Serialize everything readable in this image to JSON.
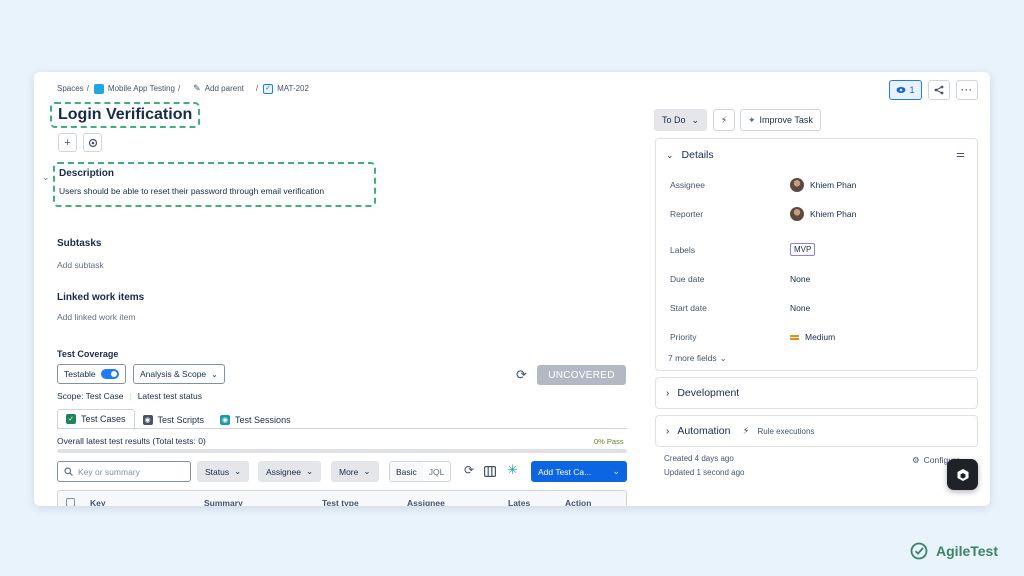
{
  "breadcrumb": {
    "spaces": "Spaces",
    "project": "Mobile App Testing",
    "add_parent": "Add parent",
    "issue_key": "MAT-202"
  },
  "header": {
    "watch_count": "1"
  },
  "issue": {
    "title": "Login Verification",
    "description_heading": "Description",
    "description": "Users should be able to reset their password through email verification"
  },
  "subtasks": {
    "heading": "Subtasks",
    "placeholder": "Add subtask"
  },
  "linked": {
    "heading": "Linked work items",
    "placeholder": "Add linked work item"
  },
  "test_coverage": {
    "heading": "Test Coverage",
    "testable_label": "Testable",
    "analysis_label": "Analysis & Scope",
    "uncovered_label": "UNCOVERED",
    "scope_label": "Scope: Test Case",
    "latest_status_label": "Latest test status",
    "tabs": [
      {
        "label": "Test Cases",
        "color": "#1f845a"
      },
      {
        "label": "Test Scripts",
        "color": "#44546f"
      },
      {
        "label": "Test Sessions",
        "color": "#1d9aaa"
      }
    ],
    "overall_label": "Overall latest test results (Total tests: 0)",
    "pass_percent": "0% Pass",
    "search_placeholder": "Key or summary",
    "filters": {
      "status": "Status",
      "assignee": "Assignee",
      "more": "More"
    },
    "basic_label": "Basic",
    "jql_label": "JQL",
    "add_test_case": "Add Test Ca...",
    "columns": [
      "Key",
      "Summary",
      "Test type",
      "Assignee",
      "Lates",
      "Action"
    ]
  },
  "sidebar": {
    "status": "To Do",
    "improve_task": "Improve Task",
    "details_heading": "Details",
    "fields": {
      "assignee_label": "Assignee",
      "assignee_value": "Khiem Phan",
      "reporter_label": "Reporter",
      "reporter_value": "Khiem Phan",
      "labels_label": "Labels",
      "labels_value": "MVP",
      "due_label": "Due date",
      "due_value": "None",
      "start_label": "Start date",
      "start_value": "None",
      "priority_label": "Priority",
      "priority_value": "Medium"
    },
    "more_fields": "7 more fields",
    "development": "Development",
    "automation": "Automation",
    "rule_executions": "Rule executions",
    "created": "Created 4 days ago",
    "updated": "Updated 1 second ago",
    "configure": "Configure"
  },
  "brand": {
    "name": "AgileTest",
    "color": "#3b8462"
  }
}
